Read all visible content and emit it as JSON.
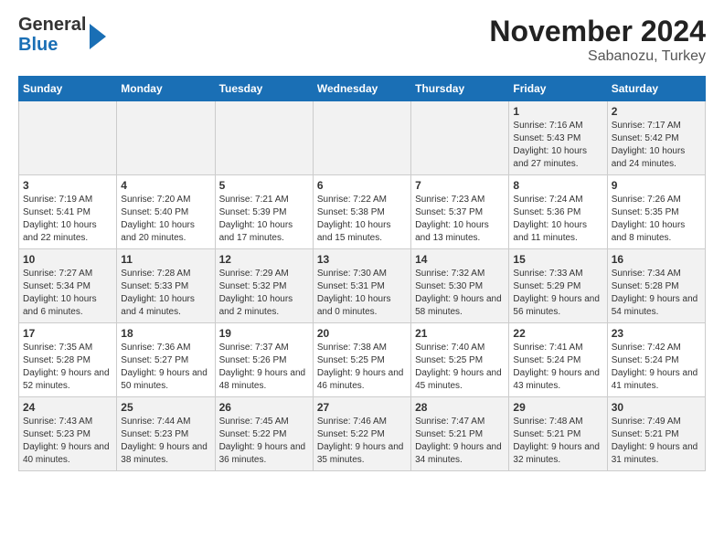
{
  "logo": {
    "general": "General",
    "blue": "Blue"
  },
  "title": "November 2024",
  "subtitle": "Sabanozu, Turkey",
  "days_of_week": [
    "Sunday",
    "Monday",
    "Tuesday",
    "Wednesday",
    "Thursday",
    "Friday",
    "Saturday"
  ],
  "weeks": [
    [
      {
        "day": "",
        "info": ""
      },
      {
        "day": "",
        "info": ""
      },
      {
        "day": "",
        "info": ""
      },
      {
        "day": "",
        "info": ""
      },
      {
        "day": "",
        "info": ""
      },
      {
        "day": "1",
        "info": "Sunrise: 7:16 AM\nSunset: 5:43 PM\nDaylight: 10 hours and 27 minutes."
      },
      {
        "day": "2",
        "info": "Sunrise: 7:17 AM\nSunset: 5:42 PM\nDaylight: 10 hours and 24 minutes."
      }
    ],
    [
      {
        "day": "3",
        "info": "Sunrise: 7:19 AM\nSunset: 5:41 PM\nDaylight: 10 hours and 22 minutes."
      },
      {
        "day": "4",
        "info": "Sunrise: 7:20 AM\nSunset: 5:40 PM\nDaylight: 10 hours and 20 minutes."
      },
      {
        "day": "5",
        "info": "Sunrise: 7:21 AM\nSunset: 5:39 PM\nDaylight: 10 hours and 17 minutes."
      },
      {
        "day": "6",
        "info": "Sunrise: 7:22 AM\nSunset: 5:38 PM\nDaylight: 10 hours and 15 minutes."
      },
      {
        "day": "7",
        "info": "Sunrise: 7:23 AM\nSunset: 5:37 PM\nDaylight: 10 hours and 13 minutes."
      },
      {
        "day": "8",
        "info": "Sunrise: 7:24 AM\nSunset: 5:36 PM\nDaylight: 10 hours and 11 minutes."
      },
      {
        "day": "9",
        "info": "Sunrise: 7:26 AM\nSunset: 5:35 PM\nDaylight: 10 hours and 8 minutes."
      }
    ],
    [
      {
        "day": "10",
        "info": "Sunrise: 7:27 AM\nSunset: 5:34 PM\nDaylight: 10 hours and 6 minutes."
      },
      {
        "day": "11",
        "info": "Sunrise: 7:28 AM\nSunset: 5:33 PM\nDaylight: 10 hours and 4 minutes."
      },
      {
        "day": "12",
        "info": "Sunrise: 7:29 AM\nSunset: 5:32 PM\nDaylight: 10 hours and 2 minutes."
      },
      {
        "day": "13",
        "info": "Sunrise: 7:30 AM\nSunset: 5:31 PM\nDaylight: 10 hours and 0 minutes."
      },
      {
        "day": "14",
        "info": "Sunrise: 7:32 AM\nSunset: 5:30 PM\nDaylight: 9 hours and 58 minutes."
      },
      {
        "day": "15",
        "info": "Sunrise: 7:33 AM\nSunset: 5:29 PM\nDaylight: 9 hours and 56 minutes."
      },
      {
        "day": "16",
        "info": "Sunrise: 7:34 AM\nSunset: 5:28 PM\nDaylight: 9 hours and 54 minutes."
      }
    ],
    [
      {
        "day": "17",
        "info": "Sunrise: 7:35 AM\nSunset: 5:28 PM\nDaylight: 9 hours and 52 minutes."
      },
      {
        "day": "18",
        "info": "Sunrise: 7:36 AM\nSunset: 5:27 PM\nDaylight: 9 hours and 50 minutes."
      },
      {
        "day": "19",
        "info": "Sunrise: 7:37 AM\nSunset: 5:26 PM\nDaylight: 9 hours and 48 minutes."
      },
      {
        "day": "20",
        "info": "Sunrise: 7:38 AM\nSunset: 5:25 PM\nDaylight: 9 hours and 46 minutes."
      },
      {
        "day": "21",
        "info": "Sunrise: 7:40 AM\nSunset: 5:25 PM\nDaylight: 9 hours and 45 minutes."
      },
      {
        "day": "22",
        "info": "Sunrise: 7:41 AM\nSunset: 5:24 PM\nDaylight: 9 hours and 43 minutes."
      },
      {
        "day": "23",
        "info": "Sunrise: 7:42 AM\nSunset: 5:24 PM\nDaylight: 9 hours and 41 minutes."
      }
    ],
    [
      {
        "day": "24",
        "info": "Sunrise: 7:43 AM\nSunset: 5:23 PM\nDaylight: 9 hours and 40 minutes."
      },
      {
        "day": "25",
        "info": "Sunrise: 7:44 AM\nSunset: 5:23 PM\nDaylight: 9 hours and 38 minutes."
      },
      {
        "day": "26",
        "info": "Sunrise: 7:45 AM\nSunset: 5:22 PM\nDaylight: 9 hours and 36 minutes."
      },
      {
        "day": "27",
        "info": "Sunrise: 7:46 AM\nSunset: 5:22 PM\nDaylight: 9 hours and 35 minutes."
      },
      {
        "day": "28",
        "info": "Sunrise: 7:47 AM\nSunset: 5:21 PM\nDaylight: 9 hours and 34 minutes."
      },
      {
        "day": "29",
        "info": "Sunrise: 7:48 AM\nSunset: 5:21 PM\nDaylight: 9 hours and 32 minutes."
      },
      {
        "day": "30",
        "info": "Sunrise: 7:49 AM\nSunset: 5:21 PM\nDaylight: 9 hours and 31 minutes."
      }
    ]
  ]
}
